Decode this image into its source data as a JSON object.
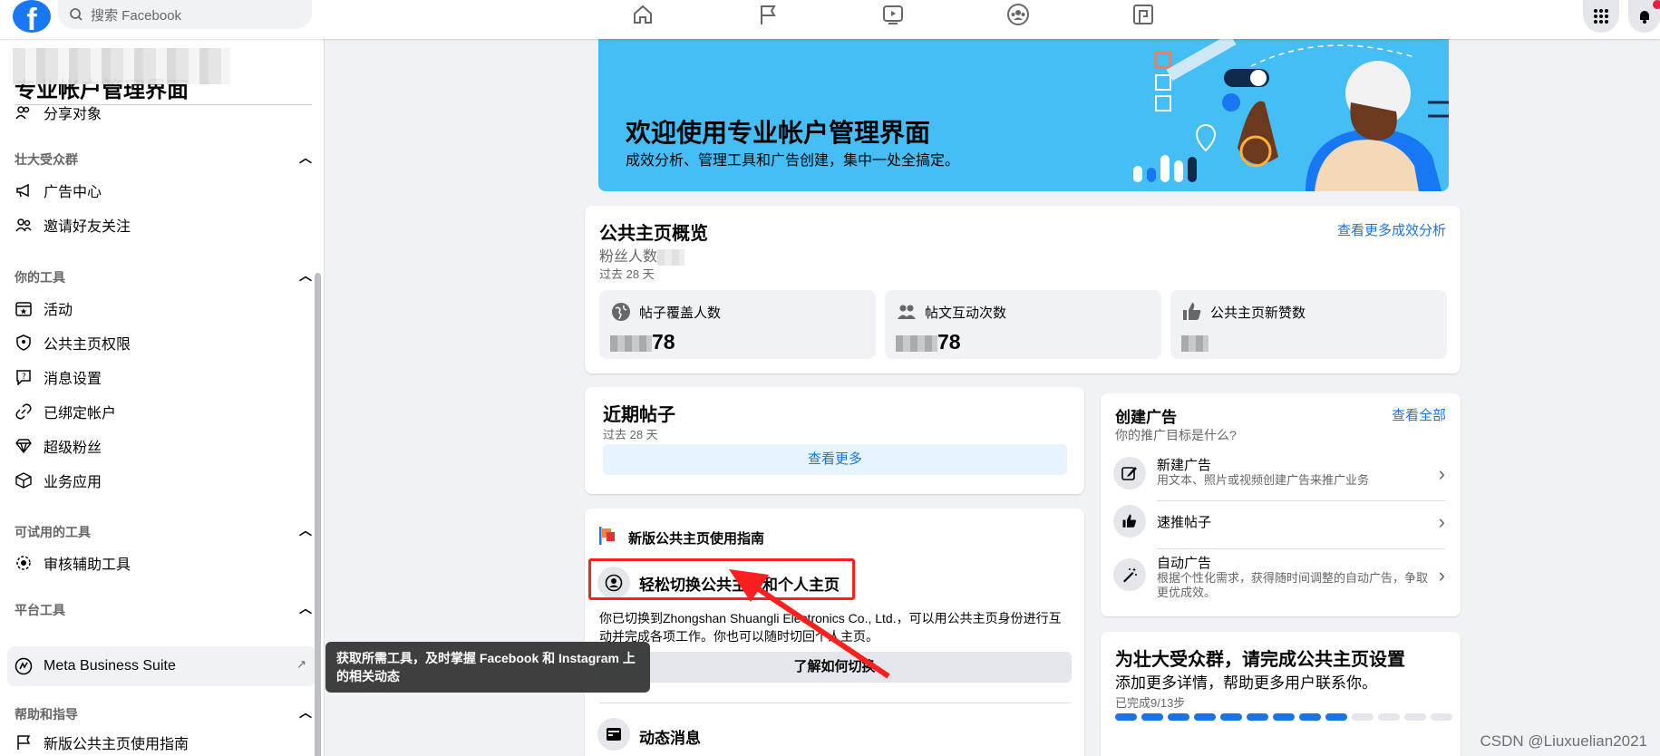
{
  "topbar": {
    "logo": "f",
    "search_placeholder": "搜索 Facebook",
    "nav_icons": [
      "home-icon",
      "flag-icon",
      "video-icon",
      "groups-icon",
      "gaming-icon"
    ],
    "right_icons": [
      "menu-grid-icon",
      "notifications-icon"
    ]
  },
  "sidebar": {
    "title": "专业帐户管理界面",
    "top_item": "分享对象",
    "sections": [
      {
        "heading": "壮大受众群",
        "items": [
          "广告中心",
          "邀请好友关注"
        ]
      },
      {
        "heading": "你的工具",
        "items": [
          "活动",
          "公共主页权限",
          "消息设置",
          "已绑定帐户",
          "超级粉丝",
          "业务应用"
        ]
      },
      {
        "heading": "可试用的工具",
        "items": [
          "审核辅助工具"
        ]
      },
      {
        "heading": "平台工具",
        "items": [
          "Meta Business Suite"
        ]
      },
      {
        "heading": "帮助和指导",
        "items": [
          "新版公共主页使用指南"
        ]
      }
    ],
    "tooltip": "获取所需工具，及时掌握 Facebook 和 Instagram 上的相关动态"
  },
  "banner": {
    "title": "欢迎使用专业帐户管理界面",
    "subtitle": "成效分析、管理工具和广告创建，集中一处全搞定。"
  },
  "overview": {
    "title": "公共主页概览",
    "more_link": "查看更多成效分析",
    "followers_label": "粉丝人数",
    "period": "过去 28 天",
    "metrics": [
      {
        "label": "帖子覆盖人数",
        "value_suffix": "78"
      },
      {
        "label": "帖文互动次数",
        "value_suffix": "78"
      },
      {
        "label": "公共主页新赞数",
        "value_suffix": ""
      }
    ]
  },
  "recent_posts": {
    "title": "近期帖子",
    "period": "过去 28 天",
    "button": "查看更多"
  },
  "guide": {
    "header": "新版公共主页使用指南",
    "switch_title": "轻松切换公共主页和个人主页",
    "switch_desc": "你已切换到Zhongshan Shuangli Electronics Co., Ltd.，可以用公共主页身份进行互动并完成各项工作。你也可以随时切回个人主页。",
    "switch_button": "了解如何切换",
    "feed_title": "动态消息"
  },
  "create_ad": {
    "title": "创建广告",
    "view_all": "查看全部",
    "question": "你的推广目标是什么?",
    "rows": [
      {
        "title": "新建广告",
        "desc": "用文本、照片或视频创建广告来推广业务"
      },
      {
        "title": "速推帖子",
        "desc": ""
      },
      {
        "title": "自动广告",
        "desc": "根据个性化需求，获得随时间调整的自动广告，争取更优成效。"
      }
    ]
  },
  "setup": {
    "title": "为壮大受众群，请完成公共主页设置",
    "subtitle": "添加更多详情，帮助更多用户联系你。",
    "progress_text": "已完成9/13步",
    "done": 9,
    "total": 13
  },
  "watermark": "CSDN @Liuxuelian2021",
  "colors": {
    "brand": "#1877f2",
    "banner": "#45bdf5",
    "link": "#1b74e4",
    "annotation": "#ff1f1f"
  }
}
